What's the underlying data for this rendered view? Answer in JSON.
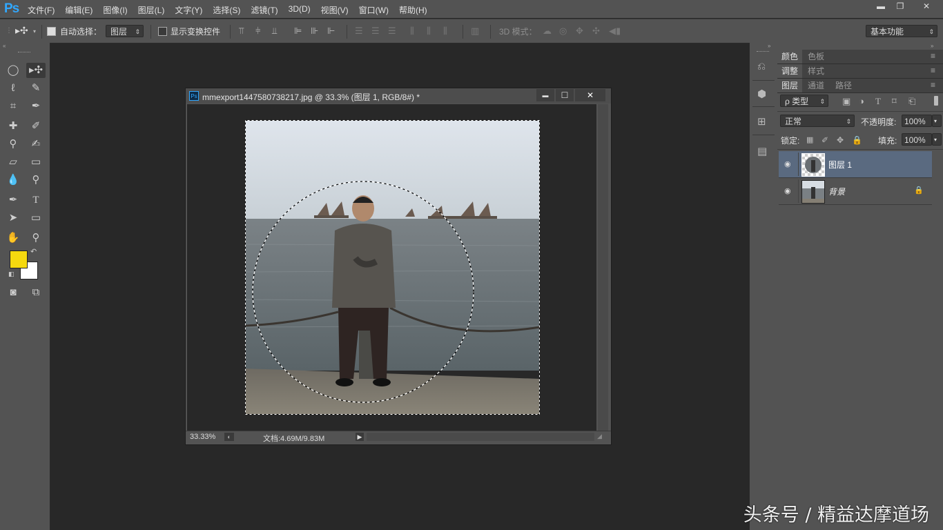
{
  "app": {
    "logo": "Ps"
  },
  "menu": [
    "文件(F)",
    "编辑(E)",
    "图像(I)",
    "图层(L)",
    "文字(Y)",
    "选择(S)",
    "滤镜(T)",
    "3D(D)",
    "视图(V)",
    "窗口(W)",
    "帮助(H)"
  ],
  "window_controls": {
    "minimize": "▬",
    "restore": "❐",
    "close": "✕"
  },
  "options": {
    "auto_select_label": "自动选择：",
    "auto_select_checked": true,
    "auto_select_value": "图层",
    "show_transform_label": "显示变换控件",
    "show_transform_checked": false,
    "mode3d_label": "3D 模式：",
    "workspace": "基本功能"
  },
  "document": {
    "title": "mmexport1447580738217.jpg @ 33.3% (图层 1, RGB/8#) *",
    "zoom": "33.33%",
    "doc_size": "文档:4.69M/9.83M",
    "controls": {
      "minimize": "▬",
      "maximize": "☐",
      "close": "✕"
    }
  },
  "colors": {
    "foreground": "#f5d90f",
    "background": "#ffffff",
    "accent": "#31a8ff"
  },
  "panels": {
    "row1_tabs": [
      "颜色",
      "色板"
    ],
    "row2_tabs": [
      "调整",
      "样式"
    ],
    "row3_tabs": [
      "图层",
      "通道",
      "路径"
    ],
    "filter_kind": "ρ 类型",
    "blend_mode": "正常",
    "opacity_label": "不透明度:",
    "opacity_value": "100%",
    "lock_label": "锁定:",
    "fill_label": "填充:",
    "fill_value": "100%",
    "layers": [
      {
        "name": "图层 1",
        "selected": true,
        "locked": false
      },
      {
        "name": "背景",
        "selected": false,
        "locked": true
      }
    ]
  },
  "watermark": "头条号 / 精益达摩道场"
}
